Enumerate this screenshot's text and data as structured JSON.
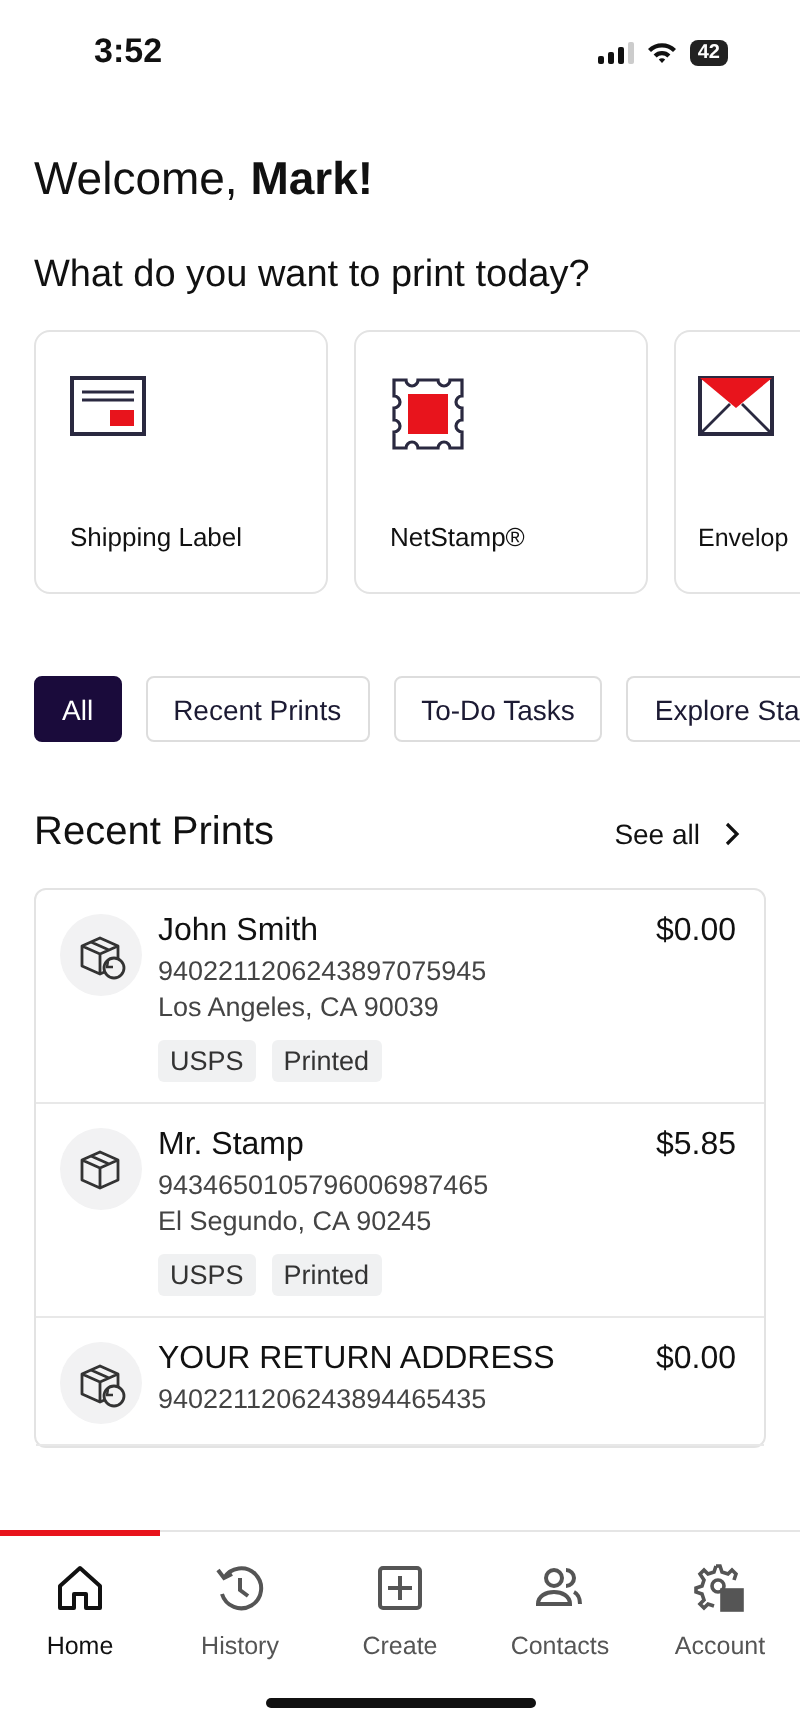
{
  "status_bar": {
    "time": "3:52",
    "battery": "42"
  },
  "greeting": {
    "prefix": "Welcome,",
    "name": "Mark!"
  },
  "print_prompt": "What do you want to print today?",
  "print_options": [
    {
      "kind": "label",
      "label": "Shipping Label"
    },
    {
      "kind": "stamp",
      "label": "NetStamp®"
    },
    {
      "kind": "envelope",
      "label": "Envelop"
    }
  ],
  "filters": [
    {
      "label": "All",
      "selected": true
    },
    {
      "label": "Recent Prints",
      "selected": false
    },
    {
      "label": "To-Do Tasks",
      "selected": false
    },
    {
      "label": "Explore Sta",
      "selected": false
    }
  ],
  "recent_prints": {
    "title": "Recent Prints",
    "see_all": "See all",
    "items": [
      {
        "kind": "return",
        "name": "John Smith",
        "tracking": "9402211206243897075945",
        "address": "Los Angeles, CA 90039",
        "price": "$0.00",
        "tags": [
          "USPS",
          "Printed"
        ]
      },
      {
        "kind": "box",
        "name": "Mr. Stamp",
        "tracking": "9434650105796006987465",
        "address": "El Segundo, CA 90245",
        "price": "$5.85",
        "tags": [
          "USPS",
          "Printed"
        ]
      },
      {
        "kind": "return",
        "name": "YOUR RETURN ADDRESS",
        "tracking": "9402211206243894465435",
        "price": "$0.00"
      }
    ]
  },
  "tab_bar": [
    {
      "kind": "home",
      "label": "Home",
      "selected": true
    },
    {
      "kind": "history",
      "label": "History",
      "selected": false
    },
    {
      "kind": "create",
      "label": "Create",
      "selected": false
    },
    {
      "kind": "contacts",
      "label": "Contacts",
      "selected": false
    },
    {
      "kind": "account",
      "label": "Account",
      "selected": false
    }
  ]
}
